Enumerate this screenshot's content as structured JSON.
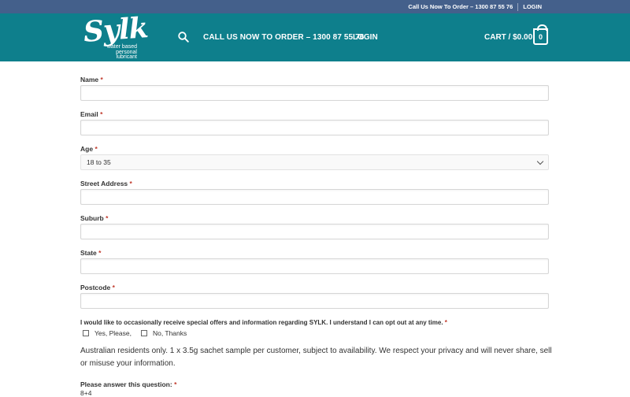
{
  "topbar": {
    "phone_text": "Call Us Now To Order – 1300 87 55 76",
    "login": "LOGIN"
  },
  "header": {
    "logo_word": "Sylk",
    "logo_tagline": [
      "water based",
      "personal",
      "lubricant"
    ],
    "call_text": "CALL US NOW TO ORDER – 1300 87 55 76",
    "login": "LOGIN",
    "cart_label": "CART / $0.00",
    "cart_count": "0"
  },
  "form": {
    "required_mark": "*",
    "fields": {
      "name": "Name",
      "email": "Email",
      "age": "Age",
      "street": "Street Address",
      "suburb": "Suburb",
      "state": "State",
      "postcode": "Postcode"
    },
    "age_selected": "18 to 35",
    "consent": "I would like to occasionally receive special offers and information regarding SYLK. I understand I can opt out at any time.",
    "options": [
      "Yes, Please,",
      "No, Thanks"
    ],
    "note": "Australian residents only. 1 x 3.5g sachet sample per customer, subject to availability. We respect your privacy and will never share, sell or misuse your information.",
    "question_label": "Please answer this question:",
    "question_text": "8+4"
  }
}
